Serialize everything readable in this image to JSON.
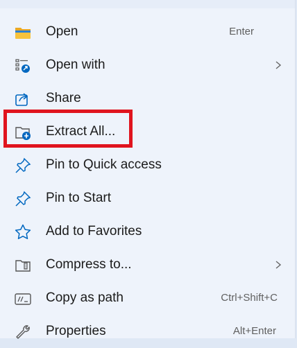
{
  "menu": {
    "items": [
      {
        "label": "Open",
        "shortcut": "Enter",
        "icon": "folder-icon"
      },
      {
        "label": "Open with",
        "shortcut": "",
        "icon": "open-with-icon",
        "submenu": true
      },
      {
        "label": "Share",
        "shortcut": "",
        "icon": "share-icon"
      },
      {
        "label": "Extract All...",
        "shortcut": "",
        "icon": "extract-folder-icon",
        "highlighted": true
      },
      {
        "label": "Pin to Quick access",
        "shortcut": "",
        "icon": "pin-icon"
      },
      {
        "label": "Pin to Start",
        "shortcut": "",
        "icon": "pin-icon"
      },
      {
        "label": "Add to Favorites",
        "shortcut": "",
        "icon": "star-icon"
      },
      {
        "label": "Compress to...",
        "shortcut": "",
        "icon": "zip-icon",
        "submenu": true
      },
      {
        "label": "Copy as path",
        "shortcut": "Ctrl+Shift+C",
        "icon": "path-icon"
      },
      {
        "label": "Properties",
        "shortcut": "Alt+Enter",
        "icon": "wrench-icon"
      }
    ]
  },
  "colors": {
    "accent": "#0067c0",
    "highlight_box": "#e0141e",
    "folder_yellow": "#f7c23c"
  }
}
